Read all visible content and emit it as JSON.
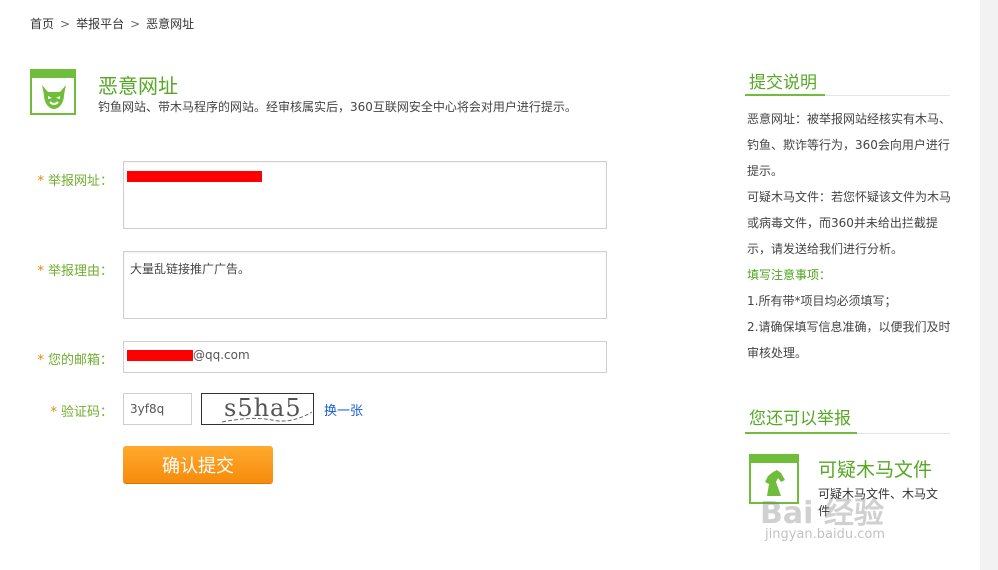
{
  "breadcrumb": {
    "home": "首页",
    "sep": ">",
    "platform": "举报平台",
    "current": "恶意网址"
  },
  "header": {
    "icon": "devil-face-icon",
    "title": "恶意网址",
    "description": "钓鱼网站、带木马程序的网站。经审核属实后，360互联网安全中心将会对用户进行提示。"
  },
  "form": {
    "required_mark": "*",
    "url_label": "举报网址：",
    "reason_label": "举报理由：",
    "reason_value": "大量乱链接推广广告。",
    "email_label": "您的邮箱：",
    "email_suffix": "@qq.com",
    "captcha_label": "验证码：",
    "captcha_value": "3yf8q",
    "captcha_image_text": "s5ha5",
    "refresh_label": "换一张",
    "submit_label": "确认提交"
  },
  "sidebar": {
    "instructions_title": "提交说明",
    "instructions": [
      "恶意网址：被举报网站经核实有木马、钓鱼、欺诈等行为，360会向用户进行提示。",
      "可疑木马文件：若您怀疑该文件为木马或病毒文件，而360并未给出拦截提示，请发送给我们进行分析。"
    ],
    "notes_title": "填写注意事项：",
    "notes": [
      "1.所有带*项目均必须填写；",
      "2.请确保填写信息准确，以便我们及时审核处理。"
    ],
    "also_report_title": "您还可以举报",
    "report_item": {
      "icon": "horse-icon",
      "title": "可疑木马文件",
      "description": "可疑木马文件、木马文件"
    }
  },
  "watermark": {
    "logo": "Bai 经验",
    "url": "jingyan.baidu.com"
  },
  "colors": {
    "accent_green": "#6fbd3b",
    "title_green": "#56a825",
    "button_orange": "#f68b0c",
    "link_blue": "#1a5fd0",
    "redaction_red": "#ff0000"
  }
}
